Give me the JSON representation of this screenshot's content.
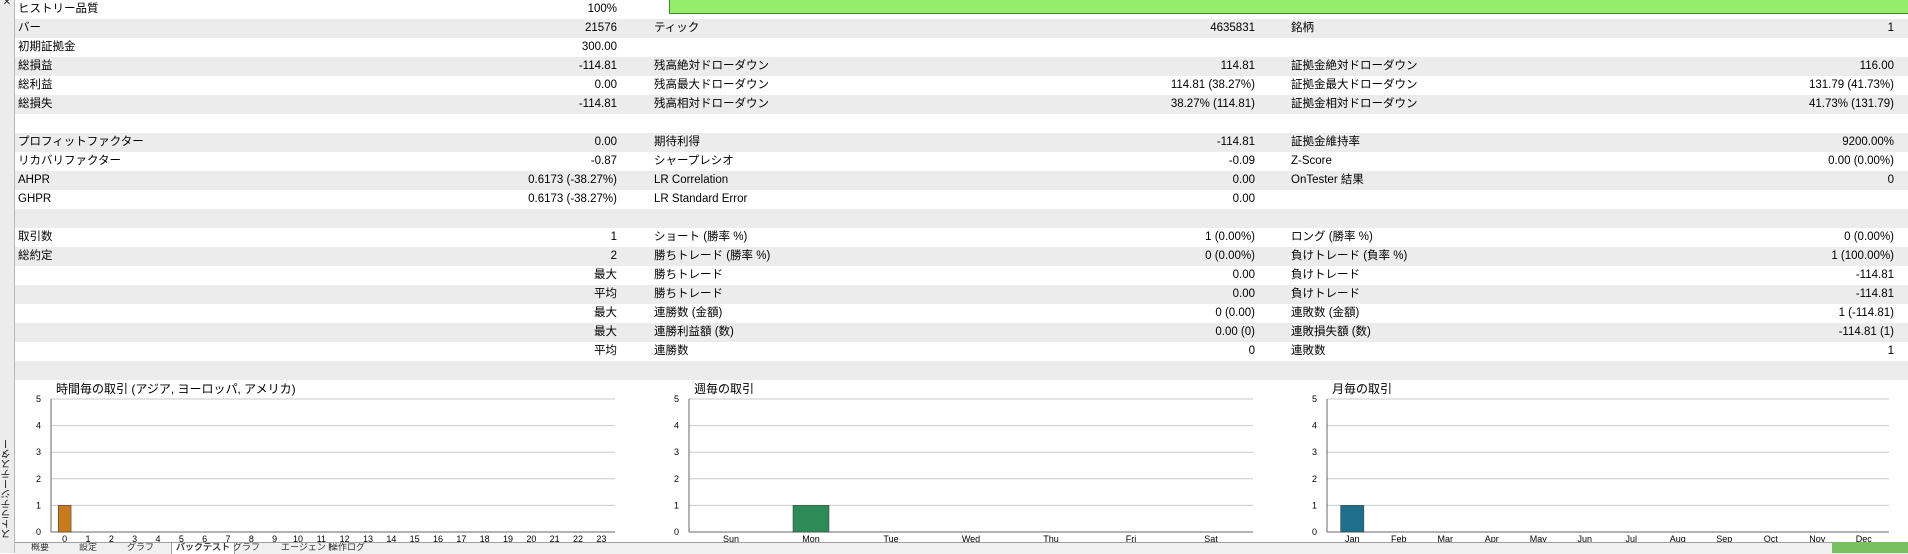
{
  "panel_title": "ストラテジーテスター",
  "history_quality": {
    "label": "ヒストリー品質",
    "value": "100%",
    "fraction": 1.0
  },
  "rows": [
    {
      "shaded": true,
      "c1": [
        "バー",
        "21576"
      ],
      "c2": [
        "ティック",
        "4635831"
      ],
      "c3": [
        "銘柄",
        "1"
      ]
    },
    {
      "shaded": false,
      "c1": [
        "初期証拠金",
        "300.00"
      ],
      "c2": [
        "",
        ""
      ],
      "c3": [
        "",
        ""
      ]
    },
    {
      "shaded": true,
      "c1": [
        "総損益",
        "-114.81"
      ],
      "c2": [
        "残高絶対ドローダウン",
        "114.81"
      ],
      "c3": [
        "証拠金絶対ドローダウン",
        "116.00"
      ]
    },
    {
      "shaded": false,
      "c1": [
        "総利益",
        "0.00"
      ],
      "c2": [
        "残高最大ドローダウン",
        "114.81 (38.27%)"
      ],
      "c3": [
        "証拠金最大ドローダウン",
        "131.79 (41.73%)"
      ]
    },
    {
      "shaded": true,
      "c1": [
        "総損失",
        "-114.81"
      ],
      "c2": [
        "残高相対ドローダウン",
        "38.27% (114.81)"
      ],
      "c3": [
        "証拠金相対ドローダウン",
        "41.73% (131.79)"
      ]
    },
    {
      "shaded": false,
      "c1": [
        "",
        ""
      ],
      "c2": [
        "",
        ""
      ],
      "c3": [
        "",
        ""
      ]
    },
    {
      "shaded": true,
      "c1": [
        "プロフィットファクター",
        "0.00"
      ],
      "c2": [
        "期待利得",
        "-114.81"
      ],
      "c3": [
        "証拠金維持率",
        "9200.00%"
      ]
    },
    {
      "shaded": false,
      "c1": [
        "リカバリファクター",
        "-0.87"
      ],
      "c2": [
        "シャープレシオ",
        "-0.09"
      ],
      "c3": [
        "Z-Score",
        "0.00 (0.00%)"
      ]
    },
    {
      "shaded": true,
      "c1": [
        "AHPR",
        "0.6173 (-38.27%)"
      ],
      "c2": [
        "LR Correlation",
        "0.00"
      ],
      "c3": [
        "OnTester 結果",
        "0"
      ]
    },
    {
      "shaded": false,
      "c1": [
        "GHPR",
        "0.6173 (-38.27%)"
      ],
      "c2": [
        "LR Standard Error",
        "0.00"
      ],
      "c3": [
        "",
        ""
      ]
    },
    {
      "shaded": true,
      "c1": [
        "",
        ""
      ],
      "c2": [
        "",
        ""
      ],
      "c3": [
        "",
        ""
      ]
    },
    {
      "shaded": false,
      "c1": [
        "取引数",
        "1"
      ],
      "c2": [
        "ショート (勝率 %)",
        "1 (0.00%)"
      ],
      "c3": [
        "ロング (勝率 %)",
        "0 (0.00%)"
      ]
    },
    {
      "shaded": true,
      "c1": [
        "総約定",
        "2"
      ],
      "c2": [
        "勝ちトレード (勝率 %)",
        "0 (0.00%)"
      ],
      "c3": [
        "負けトレード (負率 %)",
        "1 (100.00%)"
      ]
    },
    {
      "shaded": false,
      "r1": "最大",
      "c2": [
        "勝ちトレード",
        "0.00"
      ],
      "c3": [
        "負けトレード",
        "-114.81"
      ]
    },
    {
      "shaded": true,
      "r1": "平均",
      "c2": [
        "勝ちトレード",
        "0.00"
      ],
      "c3": [
        "負けトレード",
        "-114.81"
      ]
    },
    {
      "shaded": false,
      "r1": "最大",
      "c2": [
        "連勝数 (金額)",
        "0 (0.00)"
      ],
      "c3": [
        "連敗数 (金額)",
        "1 (-114.81)"
      ]
    },
    {
      "shaded": true,
      "r1": "最大",
      "c2": [
        "連勝利益額 (数)",
        "0.00 (0)"
      ],
      "c3": [
        "連敗損失額 (数)",
        "-114.81 (1)"
      ]
    },
    {
      "shaded": false,
      "r1": "平均",
      "c2": [
        "連勝数",
        "0"
      ],
      "c3": [
        "連敗数",
        "1"
      ]
    },
    {
      "shaded": true,
      "c1": [
        "",
        ""
      ],
      "c2": [
        "",
        ""
      ],
      "c3": [
        "",
        ""
      ]
    }
  ],
  "chart_data": [
    {
      "type": "bar",
      "title": "時間毎の取引 (アジア, ヨーロッパ, アメリカ)",
      "categories": [
        "0",
        "1",
        "2",
        "3",
        "4",
        "5",
        "6",
        "7",
        "8",
        "9",
        "10",
        "11",
        "12",
        "13",
        "14",
        "15",
        "16",
        "17",
        "18",
        "19",
        "20",
        "21",
        "22",
        "23"
      ],
      "values": [
        1,
        0,
        0,
        0,
        0,
        0,
        0,
        0,
        0,
        0,
        0,
        0,
        0,
        0,
        0,
        0,
        0,
        0,
        0,
        0,
        0,
        0,
        0,
        0
      ],
      "ylim": [
        0,
        5
      ],
      "yticks": [
        "0",
        "1",
        "2",
        "3",
        "4",
        "5"
      ],
      "grid": true,
      "bar_color": "#c87a1e"
    },
    {
      "type": "bar",
      "title": "週毎の取引",
      "categories": [
        "Sun",
        "Mon",
        "Tue",
        "Wed",
        "Thu",
        "Fri",
        "Sat"
      ],
      "values": [
        0,
        1,
        0,
        0,
        0,
        0,
        0
      ],
      "ylim": [
        0,
        5
      ],
      "yticks": [
        "0",
        "1",
        "2",
        "3",
        "4",
        "5"
      ],
      "grid": true,
      "bar_color": "#2e8b57"
    },
    {
      "type": "bar",
      "title": "月毎の取引",
      "categories": [
        "Jan",
        "Feb",
        "Mar",
        "Apr",
        "May",
        "Jun",
        "Jul",
        "Aug",
        "Sep",
        "Oct",
        "Nov",
        "Dec"
      ],
      "values": [
        1,
        0,
        0,
        0,
        0,
        0,
        0,
        0,
        0,
        0,
        0,
        0
      ],
      "ylim": [
        0,
        5
      ],
      "yticks": [
        "0",
        "1",
        "2",
        "3",
        "4",
        "5"
      ],
      "grid": true,
      "bar_color": "#1e6e8c"
    }
  ],
  "tabs": [
    "概要",
    "設定",
    "グラフ",
    "バックテスト",
    "グラフ",
    "エージェント",
    "操作ログ"
  ]
}
